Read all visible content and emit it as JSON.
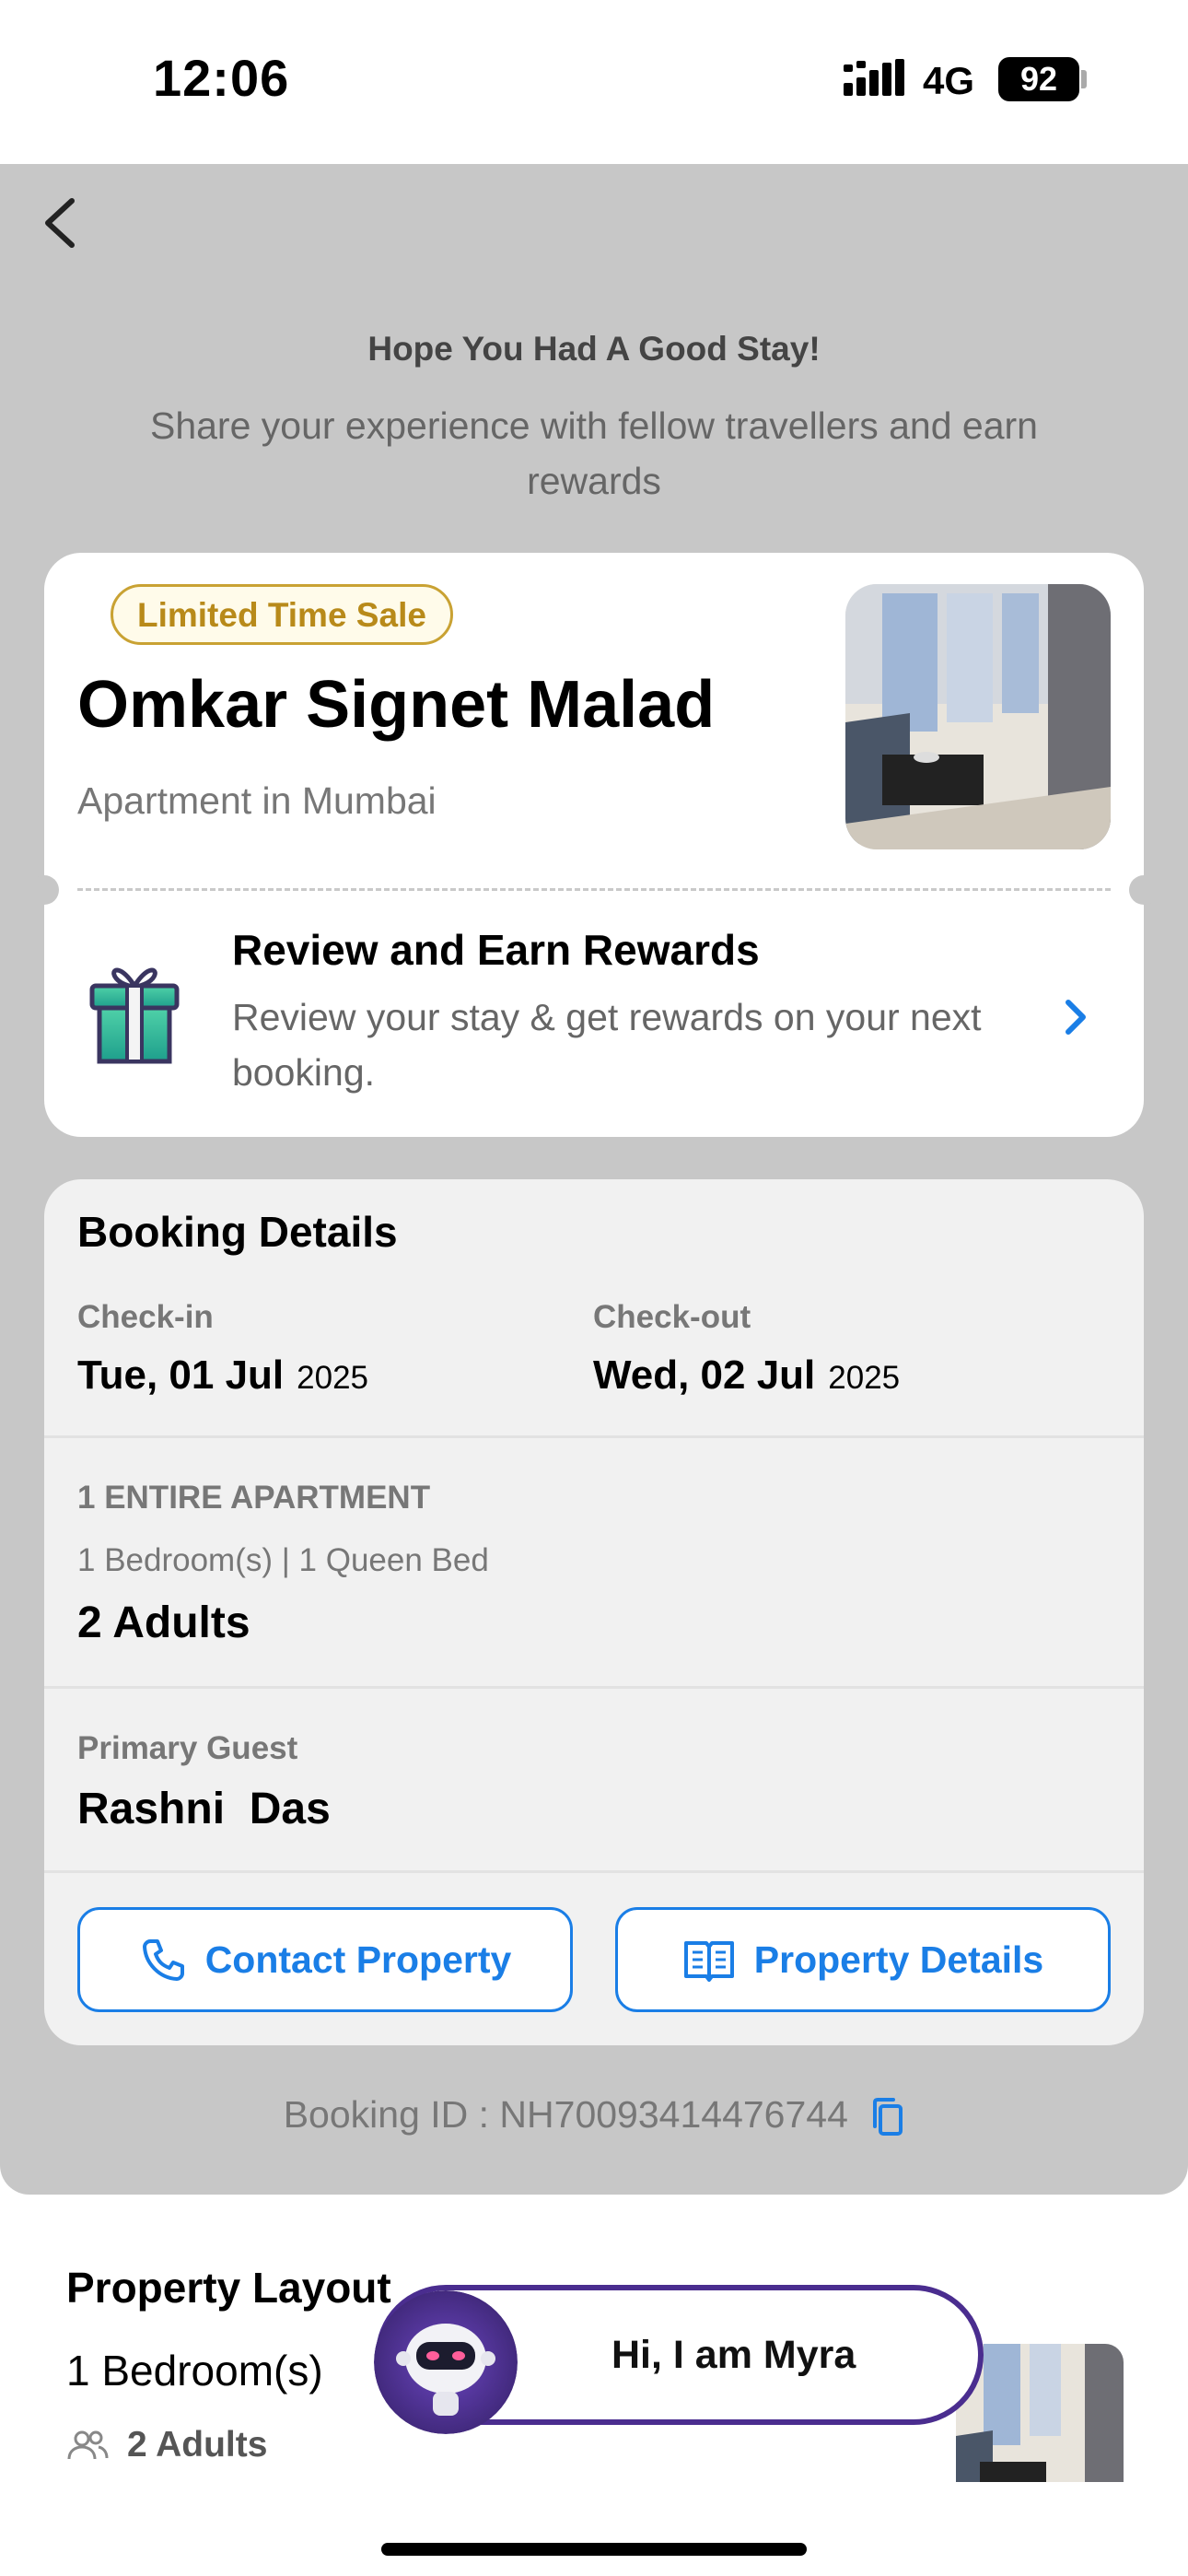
{
  "status_bar": {
    "time": "12:06",
    "network": "4G",
    "battery": "92"
  },
  "header": {
    "headline": "Hope You Had A Good Stay!",
    "subtext": "Share your experience with fellow travellers and earn rewards"
  },
  "property": {
    "badge": "Limited Time Sale",
    "name": "Omkar Signet Malad",
    "type": "Apartment in Mumbai"
  },
  "rewards": {
    "title": "Review and Earn Rewards",
    "subtitle": "Review your stay & get rewards on your next booking."
  },
  "booking": {
    "title": "Booking Details",
    "checkin_label": "Check-in",
    "checkin_date": "Tue, 01 Jul",
    "checkin_year": "2025",
    "checkout_label": "Check-out",
    "checkout_date": "Wed, 02 Jul",
    "checkout_year": "2025",
    "room_type": "1 ENTIRE APARTMENT",
    "room_beds": "1 Bedroom(s) | 1 Queen Bed",
    "guests": "2 Adults",
    "primary_guest_label": "Primary Guest",
    "primary_guest_name": "Rashni  Das",
    "contact_button": "Contact Property",
    "details_button": "Property Details",
    "booking_id": "Booking ID : NH70093414476744"
  },
  "layout": {
    "title": "Property Layout",
    "bedrooms": "1 Bedroom(s)",
    "adults": "2 Adults"
  },
  "chatbot": {
    "greeting": "Hi, I am Myra"
  },
  "colors": {
    "accent": "#1a7ee6",
    "badge_gold": "#c9a233",
    "bot_purple": "#4a2d8f",
    "background_grey": "#c7c7c7"
  },
  "icons": [
    "back-icon",
    "gift-icon",
    "chevron-right-icon",
    "phone-icon",
    "book-icon",
    "copy-icon",
    "users-icon",
    "bot-avatar"
  ]
}
